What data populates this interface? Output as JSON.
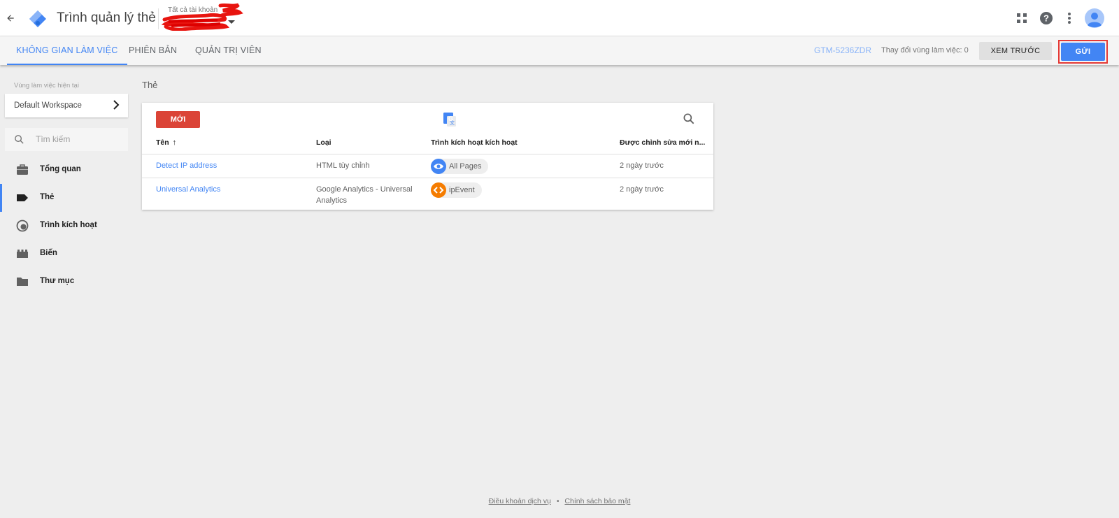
{
  "header": {
    "app_title": "Trình quản lý thẻ",
    "account_label": "Tất cả tài khoản"
  },
  "nav": {
    "tabs": [
      {
        "label": "KHÔNG GIAN LÀM VIỆC",
        "active": true
      },
      {
        "label": "PHIÊN BẢN",
        "active": false
      },
      {
        "label": "QUẢN TRỊ VIÊN",
        "active": false
      }
    ],
    "container_id": "GTM-5236ZDR",
    "workspace_changes": "Thay đổi vùng làm việc: 0",
    "preview_label": "XEM TRƯỚC",
    "submit_label": "GỬI"
  },
  "sidebar": {
    "current_workspace_label": "Vùng làm việc hiện tại",
    "workspace_name": "Default Workspace",
    "search_placeholder": "Tìm kiếm",
    "items": [
      {
        "label": "Tổng quan",
        "icon": "briefcase-icon",
        "active": false
      },
      {
        "label": "Thẻ",
        "icon": "tag-icon",
        "active": true
      },
      {
        "label": "Trình kích hoạt",
        "icon": "trigger-icon",
        "active": false
      },
      {
        "label": "Biến",
        "icon": "variable-icon",
        "active": false
      },
      {
        "label": "Thư mục",
        "icon": "folder-icon",
        "active": false
      }
    ]
  },
  "main": {
    "section_title": "Thẻ",
    "new_button": "MỚI",
    "columns": [
      "Tên",
      "Loại",
      "Trình kích hoạt kích hoạt",
      "Được chỉnh sửa mới n..."
    ],
    "rows": [
      {
        "name": "Detect IP address",
        "type_line1": "HTML tùy chỉnh",
        "type_line2": "",
        "trigger": "All Pages",
        "trigger_icon": "eye-icon",
        "trigger_color": "#4285f4",
        "edited": "2 ngày trước"
      },
      {
        "name": "Universal Analytics",
        "type_line1": "Google Analytics - Universal",
        "type_line2": "Analytics",
        "trigger": "ipEvent",
        "trigger_icon": "code-icon",
        "trigger_color": "#f57c00",
        "edited": "2 ngày trước"
      }
    ]
  },
  "footer": {
    "terms": "Điều khoản dịch vụ",
    "separator": "•",
    "privacy": "Chính sách bảo mật"
  },
  "colors": {
    "accent": "#4285f4",
    "new_button": "#db4437",
    "highlight": "#e53935"
  }
}
